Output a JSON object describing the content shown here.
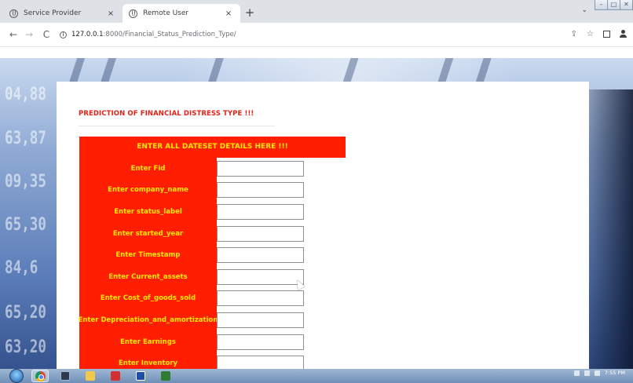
{
  "browser": {
    "tabs": [
      {
        "title": "Service Provider",
        "close": "×"
      },
      {
        "title": "Remote User",
        "close": "×"
      }
    ],
    "new_tab": "+",
    "url_host": "127.0.0.1",
    "url_path": ":8000/Financial_Status_Prediction_Type/",
    "nav": {
      "back": "←",
      "forward": "→",
      "reload": "C"
    },
    "tab_list_chevron": "⌄",
    "window_controls": {
      "minimize": "–",
      "maximize": "□",
      "close": "✕"
    },
    "share": "⇪",
    "bookmark": "☆"
  },
  "banner_digits": [
    "04,88",
    "63,87",
    "09,35",
    "65,30",
    "84,6",
    "65,20",
    "63,20"
  ],
  "page": {
    "heading": "PREDICTION OF FINANCIAL DISTRESS TYPE !!!",
    "form_header": "ENTER ALL DATESET DETAILS HERE !!!",
    "fields": [
      {
        "label": "Enter Fid",
        "value": ""
      },
      {
        "label": "Enter company_name",
        "value": ""
      },
      {
        "label": "Enter status_label",
        "value": ""
      },
      {
        "label": "Enter started_year",
        "value": ""
      },
      {
        "label": "Enter Timestamp",
        "value": ""
      },
      {
        "label": "Enter Current_assets",
        "value": ""
      },
      {
        "label": "Enter Cost_of_goods_sold",
        "value": ""
      },
      {
        "label": "Enter Depreciation_and_amortization",
        "value": ""
      },
      {
        "label": "Enter Earnings",
        "value": ""
      },
      {
        "label": "Enter Inventory",
        "value": ""
      }
    ]
  },
  "taskbar": {
    "clock": "7:55 PM",
    "icons": [
      "chrome-icon",
      "terminal-icon",
      "folder-icon",
      "pdf-icon",
      "python-icon",
      "spreadsheet-icon"
    ]
  },
  "colors": {
    "accent_red": "#ff1e00",
    "label_yellow": "#ffe600",
    "heading_red": "#e2231a"
  }
}
